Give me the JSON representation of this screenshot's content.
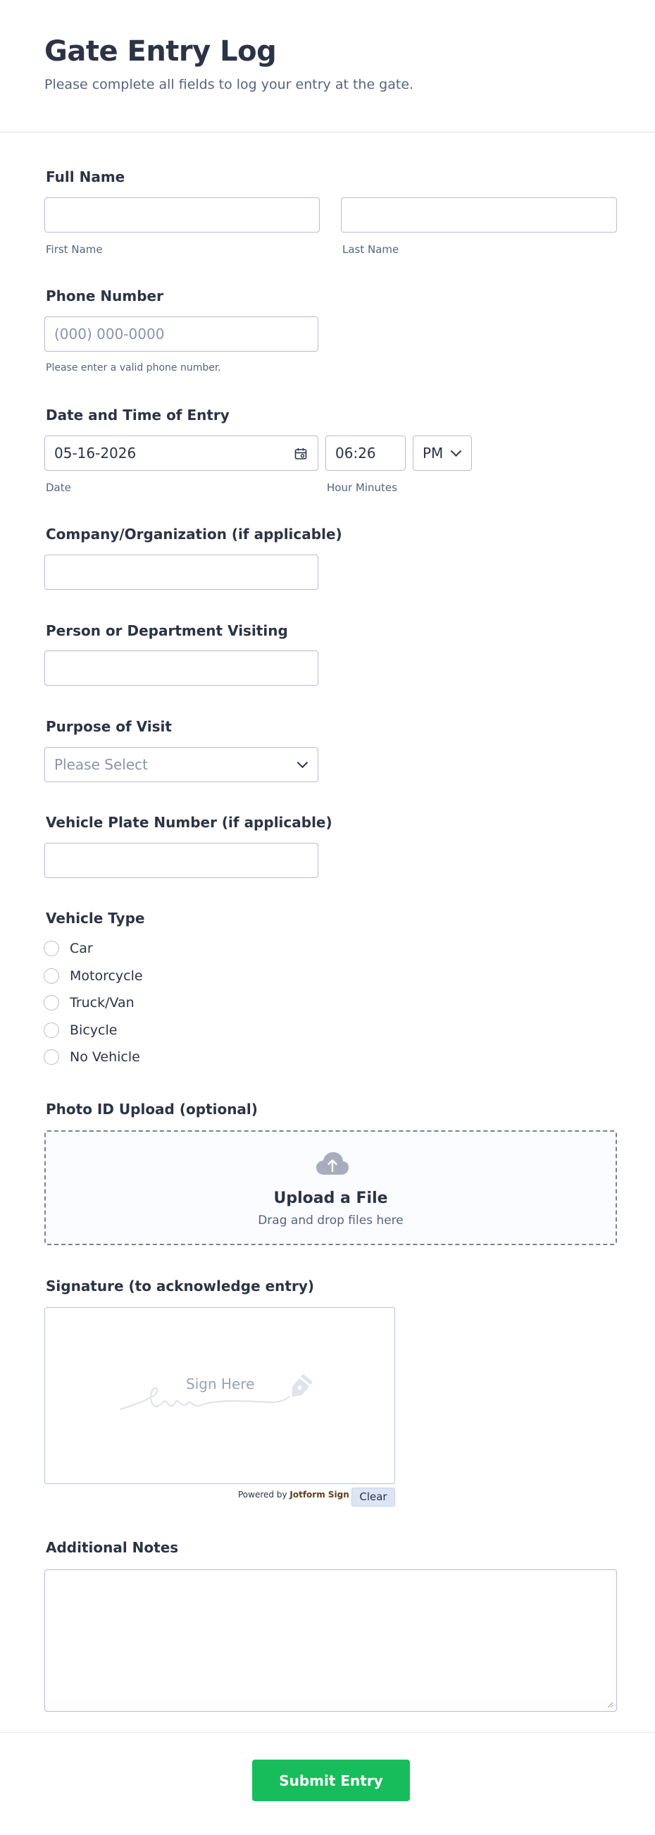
{
  "header": {
    "title": "Gate Entry Log",
    "subtitle": "Please complete all fields to log your entry at the gate."
  },
  "full_name": {
    "label": "Full Name",
    "first_value": "",
    "first_sublabel": "First Name",
    "last_value": "",
    "last_sublabel": "Last Name"
  },
  "phone": {
    "label": "Phone Number",
    "placeholder": "(000) 000-0000",
    "sublabel": "Please enter a valid phone number."
  },
  "datetime": {
    "label": "Date and Time of Entry",
    "date_value": "05-16-2026",
    "date_sublabel": "Date",
    "time_value": "06:26",
    "ampm_value": "PM",
    "time_sublabel": "Hour Minutes"
  },
  "company": {
    "label": "Company/Organization (if applicable)",
    "value": ""
  },
  "visiting": {
    "label": "Person or Department Visiting",
    "value": ""
  },
  "purpose": {
    "label": "Purpose of Visit",
    "placeholder": "Please Select"
  },
  "plate": {
    "label": "Vehicle Plate Number (if applicable)",
    "value": ""
  },
  "vehicle_type": {
    "label": "Vehicle Type",
    "options": [
      "Car",
      "Motorcycle",
      "Truck/Van",
      "Bicycle",
      "No Vehicle"
    ]
  },
  "photo_id": {
    "label": "Photo ID Upload (optional)",
    "title": "Upload a File",
    "subtitle": "Drag and drop files here"
  },
  "signature": {
    "label": "Signature (to acknowledge entry)",
    "placeholder": "Sign Here",
    "powered_prefix": "Powered by",
    "powered_brand": "Jotform Sign",
    "clear_label": "Clear"
  },
  "notes": {
    "label": "Additional Notes",
    "value": ""
  },
  "submit": {
    "label": "Submit Entry",
    "color": "#18bd5b"
  }
}
